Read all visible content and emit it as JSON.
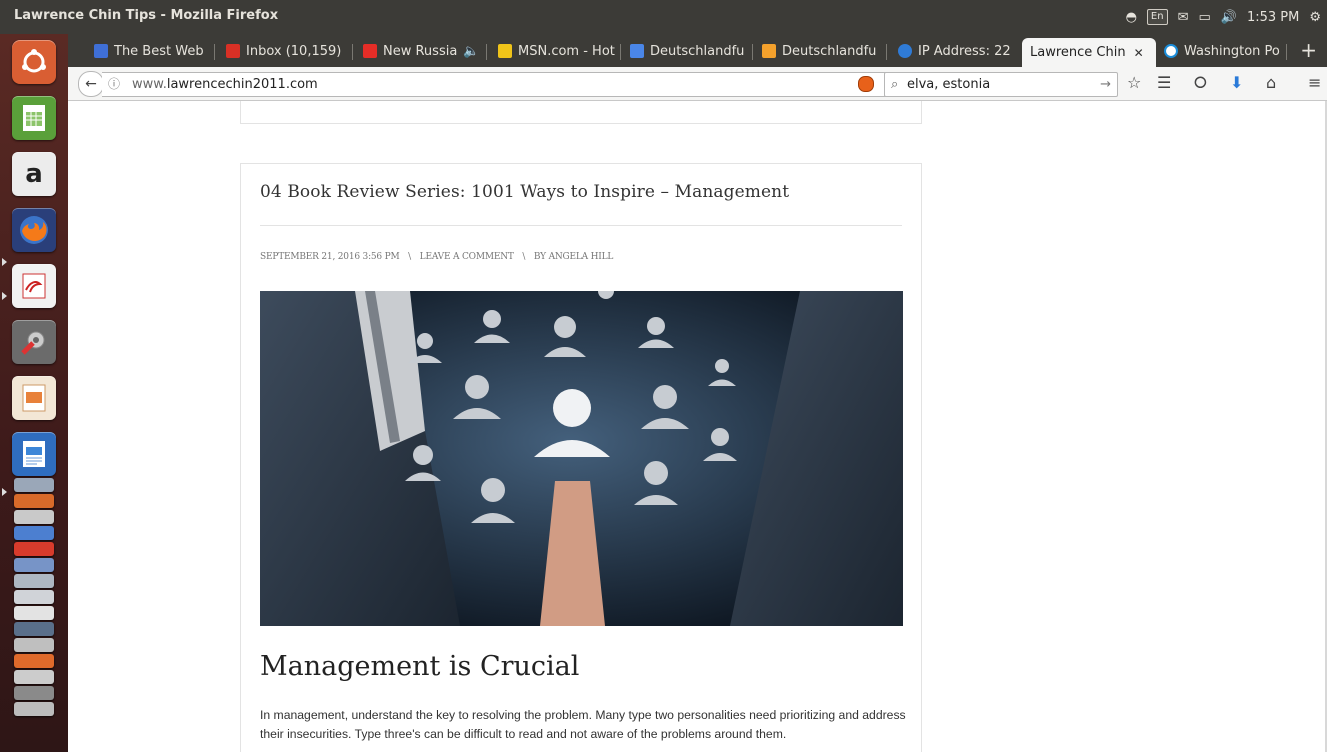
{
  "window": {
    "title": "Lawrence Chin Tips - Mozilla Firefox"
  },
  "indicators": {
    "keyboard": "En",
    "clock": "1:53 PM"
  },
  "tabs": [
    {
      "label": "The Best Web",
      "color": "#3f6fd6"
    },
    {
      "label": "Inbox (10,159)",
      "color": "#d93025"
    },
    {
      "label": "New Russia",
      "color": "#e52d27"
    },
    {
      "label": "MSN.com - Hot",
      "color": "#f0c419"
    },
    {
      "label": "Deutschlandfu",
      "color": "#4a86e8"
    },
    {
      "label": "Deutschlandfu",
      "color": "#f4a12c"
    },
    {
      "label": "IP Address: 22",
      "color": "#2f7bd6"
    },
    {
      "label": "Lawrence Chin",
      "color": "#cccccc"
    },
    {
      "label": "Washington Po",
      "color": "#1a8cd8"
    }
  ],
  "navbar": {
    "url_prefix": "www.",
    "url_domain": "lawrencechin2011.com",
    "search_query": "elva, estonia"
  },
  "post": {
    "title": "04 Book Review Series: 1001 Ways to Inspire – Management",
    "date": "SEPTEMBER 21, 2016 3:56 PM",
    "sep": "\\",
    "comment_link": "LEAVE A COMMENT",
    "author": "BY ANGELA HILL",
    "heading": "Management is Crucial",
    "paragraph": "In management, understand the key to resolving the problem. Many type two personalities need prioritizing and address their insecurities. Type three's can be difficult to read and not aware of the problems around them."
  }
}
